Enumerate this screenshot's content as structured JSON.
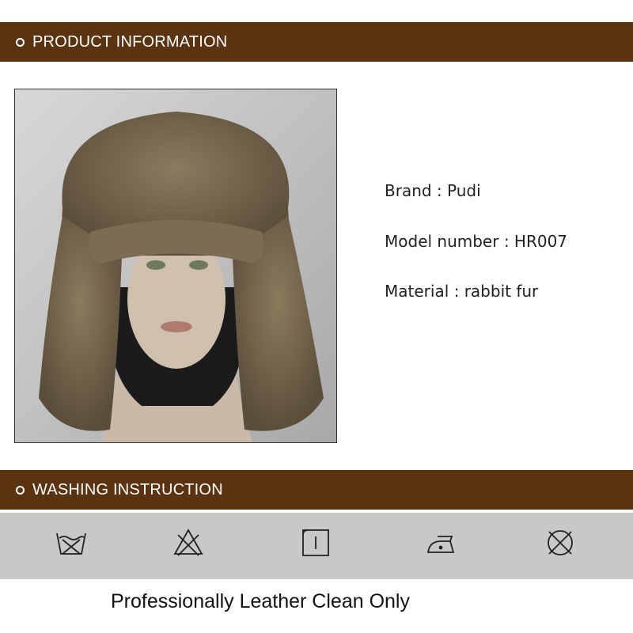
{
  "sections": {
    "product_title": "PRODUCT INFORMATION",
    "washing_title": "WASHING INSTRUCTION"
  },
  "product": {
    "brand": "Brand : Pudi",
    "model": "Model number : HR007",
    "material": "Material : rabbit fur"
  },
  "washing": {
    "icons": [
      "do-not-wash-icon",
      "do-not-bleach-icon",
      "tumble-dry-icon",
      "iron-icon",
      "do-not-dry-clean-icon"
    ],
    "note": "Professionally Leather Clean Only"
  },
  "colors": {
    "bar": "#5a3411",
    "icon_strip": "#c8c8c8"
  }
}
